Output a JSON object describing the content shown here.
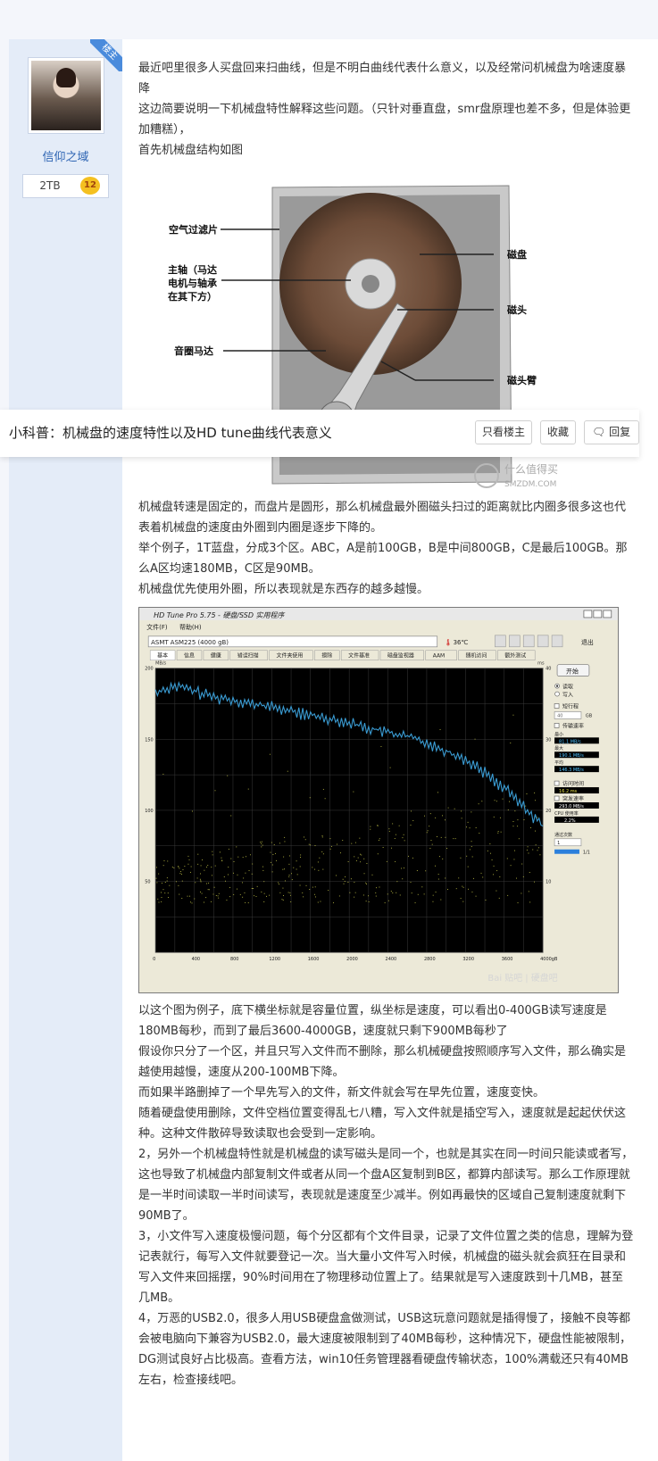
{
  "author": {
    "badge": "楼主",
    "name": "信仰之域",
    "stat": "2TB",
    "level": "12"
  },
  "post": {
    "p1": "最近吧里很多人买盘回来扫曲线，但是不明白曲线代表什么意义，以及经常问机械盘为啥速度暴降",
    "p2": "这边简要说明一下机械盘特性解释这些问题。（只针对垂直盘，smr盘原理也差不多，但是体验更加糟糕），",
    "p3": "首先机械盘结构如图",
    "p4": "机械盘转速是固定的，而盘片是圆形，那么机械盘最外圈磁头扫过的距离就比内圈多很多这也代表着机械盘的速度由外圈到内圈是逐步下降的。",
    "p5": "举个例子，1T蓝盘，分成3个区。ABC，A是前100GB，B是中间800GB，C是最后100GB。那么A区均速180MB，C区是90MB。",
    "p6": "机械盘优先使用外圈，所以表现就是东西存的越多越慢。",
    "p7": "以这个图为例子，底下横坐标就是容量位置，纵坐标是速度，可以看出0-400GB读写速度是180MB每秒，而到了最后3600-4000GB，速度就只剩下900MB每秒了",
    "p8": "假设你只分了一个区，并且只写入文件而不删除，那么机械硬盘按照顺序写入文件，那么确实是越使用越慢，速度从200-100MB下降。",
    "p9": "而如果半路删掉了一个早先写入的文件，新文件就会写在早先位置，速度变快。",
    "p10": "随着硬盘使用删除，文件空档位置变得乱七八糟，写入文件就是插空写入，速度就是起起伏伏这种。这种文件散碎导致读取也会受到一定影响。",
    "p11": "2，另外一个机械盘特性就是机械盘的读写磁头是同一个，也就是其实在同一时间只能读或者写，这也导致了机械盘内部复制文件或者从同一个盘A区复制到B区，都算内部读写。那么工作原理就是一半时间读取一半时间读写，表现就是速度至少减半。例如再最快的区域自己复制速度就剩下90MB了。",
    "p12": "3，小文件写入速度极慢问题，每个分区都有个文件目录，记录了文件位置之类的信息，理解为登记表就行，每写入文件就要登记一次。当大量小文件写入时候，机械盘的磁头就会疯狂在目录和写入文件来回摇摆，90%时间用在了物理移动位置上了。结果就是写入速度跌到十几MB，甚至几MB。",
    "p13": "4，万恶的USB2.0，很多人用USB硬盘盒做测试，USB这玩意问题就是插得慢了，接触不良等都会被电脑向下兼容为USB2.0，最大速度被限制到了40MB每秒，这种情况下，硬盘性能被限制，DG测试良好占比极高。查看方法，win10任务管理器看硬盘传输状态，100%满载还只有40MB左右，检查接线吧。"
  },
  "hdd_diagram": {
    "labels": {
      "filter": "空气过滤片",
      "spindle": "主轴（马达电机与轴承在其下方）",
      "spindle_l1": "主轴（马达",
      "spindle_l2": "电机与轴承",
      "spindle_l3": "在其下方）",
      "coil": "音圈马达",
      "platter": "磁盘",
      "head": "磁头",
      "arm": "磁头臂"
    },
    "watermark": "什么值得买",
    "watermark_sub": "SMZDM.COM"
  },
  "hdtune": {
    "title": "HD Tune Pro 5.75 - 硬盘/SSD 实用程序",
    "menu": [
      "文件(F)",
      "帮助(H)"
    ],
    "drive": "ASMT    ASM225 (4000 gB)",
    "temp": "36℃",
    "exit": "退出",
    "tabs": [
      "基本",
      "信息",
      "健康",
      "错误扫描",
      "文件夹使用",
      "擦除",
      "文件基准",
      "磁盘监视器",
      "AAM",
      "随机访问",
      "额外测试"
    ],
    "start": "开始",
    "read": "读取",
    "write": "写入",
    "short_stroke": "短行程",
    "gb": "GB",
    "stroke_value": "40",
    "transfer_rate": "传输速率",
    "min_label": "最小",
    "min_val": "81.1 MB/s",
    "max_label": "最大",
    "max_val": "190.1 MB/s",
    "avg_label": "平均",
    "avg_val": "146.3 MB/s",
    "access_time": "访问时间",
    "access_val": "16.2 ms",
    "burst": "突发速率",
    "burst_val": "293.0 MB/s",
    "cpu": "CPU 使用率",
    "cpu_val": "2.2%",
    "passes": "通过次数",
    "passes_val": "1",
    "progress": "1/1",
    "unit_left": "MB/s",
    "unit_right": "ms",
    "watermark": "Bai 贴吧 | 硬盘吧"
  },
  "chart_data": {
    "type": "line",
    "xlabel": "",
    "ylabel": "MB/s",
    "x_ticks": [
      "0",
      "400",
      "800",
      "1200",
      "1600",
      "2000",
      "2400",
      "2800",
      "3200",
      "3600",
      "4000gB"
    ],
    "y_ticks_left": [
      "200",
      "150",
      "100",
      "50"
    ],
    "y_ticks_right": [
      "40",
      "30",
      "20",
      "10"
    ],
    "xlim": [
      0,
      4000
    ],
    "ylim": [
      0,
      200
    ],
    "series": [
      {
        "x": [
          0,
          200,
          400,
          600,
          800,
          1000,
          1200,
          1400,
          1600,
          1800,
          2000,
          2200,
          2400,
          2600,
          2800,
          3000,
          3200,
          3400,
          3600,
          3800,
          4000
        ],
        "values": [
          183,
          188,
          184,
          180,
          178,
          175,
          173,
          170,
          167,
          165,
          162,
          158,
          155,
          152,
          148,
          142,
          136,
          127,
          116,
          103,
          89
        ]
      }
    ],
    "grid": true
  },
  "toolbar": {
    "title": "小科普：机械盘的速度特性以及HD tune曲线代表意义",
    "only_op": "只看楼主",
    "favorite": "收藏",
    "reply": "回复"
  }
}
